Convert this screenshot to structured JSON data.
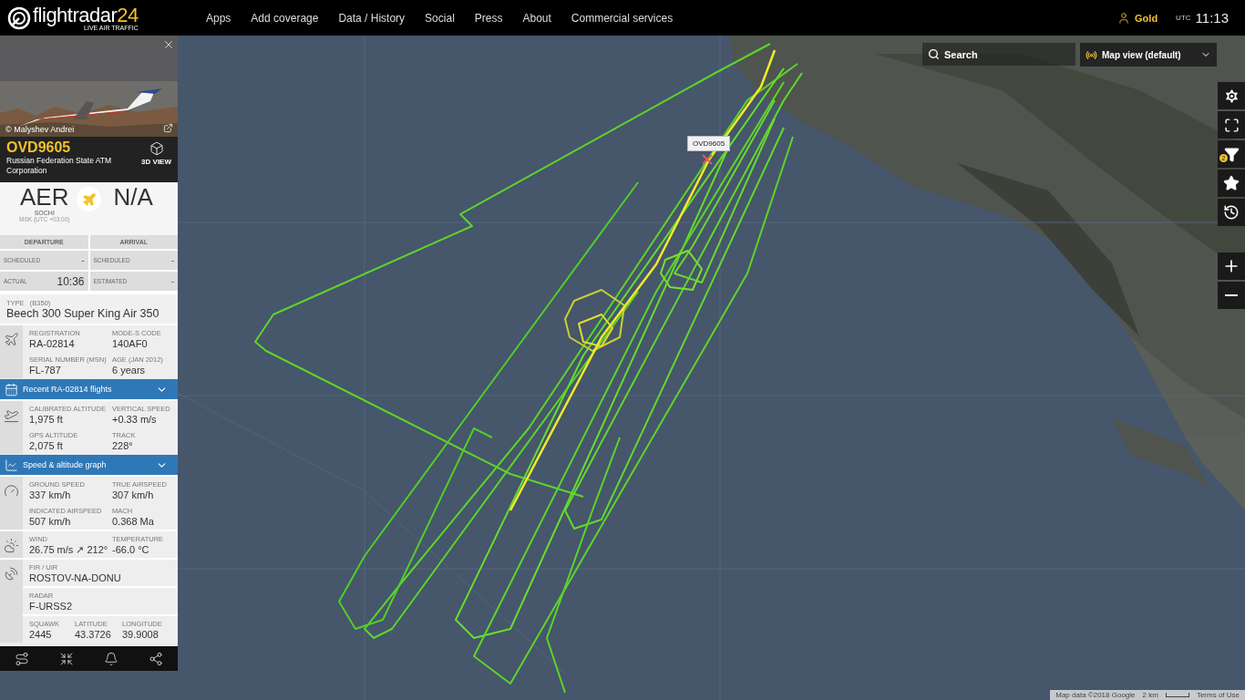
{
  "header": {
    "logo": {
      "name": "flightradar",
      "suffix": "24",
      "tagline": "LIVE AIR TRAFFIC"
    },
    "nav": [
      "Apps",
      "Add coverage",
      "Data / History",
      "Social",
      "Press",
      "About",
      "Commercial services"
    ],
    "account": "Gold",
    "clock_zone": "UTC",
    "clock": "11:13"
  },
  "flight_panel": {
    "photo": {
      "kind": "picture",
      "credit": "© Malyshev Andrei"
    },
    "callsign": "OVD9605",
    "operator": "Russian Federation State ATM Corporation",
    "view_3d": "3D VIEW",
    "route": {
      "origin": "AER",
      "origin_city": "SOCHI",
      "origin_tz": "MSK (UTC +03:00)",
      "destination": "N/A"
    },
    "schedule": {
      "columns": [
        "DEPARTURE",
        "ARRIVAL"
      ],
      "rows": [
        [
          {
            "label": "SCHEDULED",
            "value": "-"
          },
          {
            "label": "SCHEDULED",
            "value": "-"
          }
        ],
        [
          {
            "label": "ACTUAL",
            "value": "10:36"
          },
          {
            "label": "ESTIMATED",
            "value": "-"
          }
        ]
      ]
    },
    "type": {
      "label": "TYPE",
      "code": "(B350)",
      "value": "Beech 300 Super King Air 350"
    },
    "blocks": [
      {
        "kind": "aircraft",
        "rows": [
          [
            {
              "label": "REGISTRATION",
              "value": "RA-02814"
            },
            {
              "label": "MODE-S CODE",
              "value": "140AF0"
            }
          ],
          [
            {
              "label": "SERIAL NUMBER (MSN)",
              "value": "FL-787"
            },
            {
              "label": "AGE  (JAN 2012)",
              "value": "6 years"
            }
          ]
        ]
      },
      {
        "kind": "flights",
        "label": "Recent RA-02814 flights"
      },
      {
        "kind": "altitude",
        "rows": [
          [
            {
              "label": "CALIBRATED ALTITUDE",
              "value": "1,975 ft"
            },
            {
              "label": "VERTICAL SPEED",
              "value": "+0.33 m/s"
            }
          ],
          [
            {
              "label": "GPS ALTITUDE",
              "value": "2,075 ft"
            },
            {
              "label": "TRACK",
              "value": "228°"
            }
          ]
        ]
      },
      {
        "kind": "graph",
        "label": "Speed & altitude graph"
      },
      {
        "kind": "speed",
        "rows": [
          [
            {
              "label": "GROUND SPEED",
              "value": "337 km/h"
            },
            {
              "label": "TRUE AIRSPEED",
              "value": "307 km/h"
            }
          ],
          [
            {
              "label": "INDICATED AIRSPEED",
              "value": "507 km/h"
            },
            {
              "label": "MACH",
              "value": "0.368 Ma"
            }
          ]
        ]
      },
      {
        "kind": "weather",
        "rows": [
          [
            {
              "label": "WIND",
              "value": "26.75 m/s ↗ 212°"
            },
            {
              "label": "TEMPERATURE",
              "value": "-66.0 °C"
            }
          ]
        ]
      },
      {
        "kind": "airspace",
        "rows": [
          [
            {
              "label": "FIR / UIR",
              "value": "ROSTOV-NA-DONU"
            }
          ],
          [
            {
              "label": "RADAR",
              "value": "F-URSS2"
            }
          ],
          [
            {
              "label": "SQUAWK",
              "value": "2445"
            },
            {
              "label": "LATITUDE",
              "value": "43.3726"
            },
            {
              "label": "LONGITUDE",
              "value": "39.9008"
            }
          ]
        ]
      }
    ]
  },
  "map": {
    "search": {
      "placeholder": "Search"
    },
    "view_select": "Map view (default)",
    "filter_count": "2",
    "flight_label": "OVD9605",
    "attribution": {
      "data": "Map data ©2018 Google",
      "scale": "2 km",
      "terms": "Terms of Use"
    }
  }
}
